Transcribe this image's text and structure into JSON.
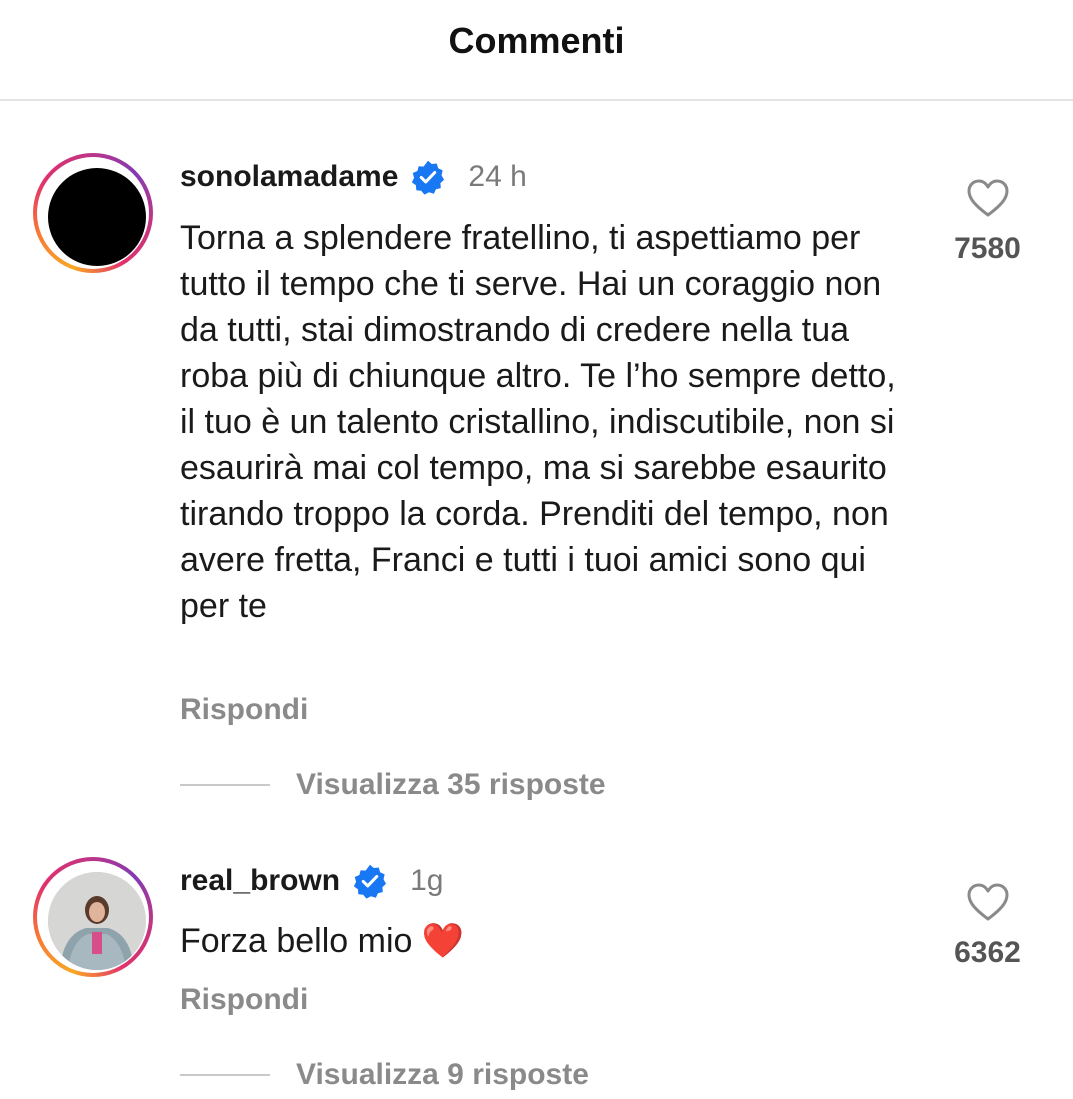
{
  "header": {
    "title": "Commenti"
  },
  "comments": [
    {
      "username": "sonolamadame",
      "time": "24 h",
      "text": "Torna a splendere fratellino, ti aspettiamo per tutto il tempo che ti serve. Hai un coraggio non da tutti, stai dimostrando di credere nella tua roba più di chiunque altro. Te l’ho sempre detto, il tuo è un talento cristallino, indiscutibile, non si esaurirà mai col tempo, ma si sarebbe esaurito tirando troppo la corda. Prenditi del tempo, non avere fretta, Franci e tutti i tuoi amici sono qui per te",
      "reply_label": "Rispondi",
      "view_replies": "Visualizza 35 risposte",
      "likes": "7580"
    },
    {
      "username": "real_brown",
      "time": "1g",
      "text": "Forza bello mio ❤️",
      "reply_label": "Rispondi",
      "view_replies": "Visualizza 9 risposte",
      "likes": "6362"
    }
  ],
  "colors": {
    "verified": "#1877f2",
    "muted": "#8a8a8a",
    "story_ring": "#e1306c"
  }
}
